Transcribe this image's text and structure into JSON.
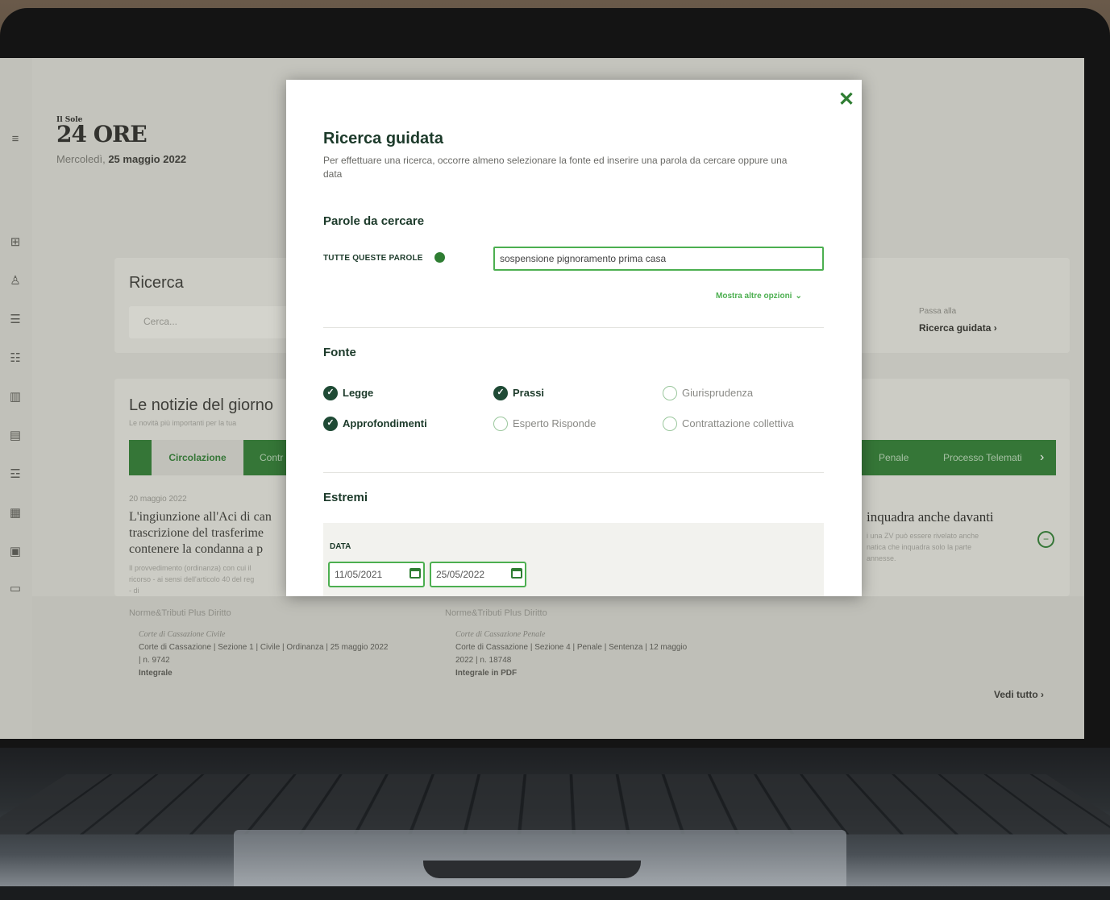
{
  "background": {
    "logo": "24 ORE",
    "logo_small": "Il Sole",
    "date_prefix": "Mercoledì,",
    "date_value": "25 maggio 2022",
    "search_title": "Ricerca",
    "search_placeholder": "Cerca...",
    "passa": "Passa alla",
    "ricerca_guidata_link": "Ricerca guidata",
    "news_title": "Le notizie del giorno",
    "news_subtitle": "Le novità più importanti per la tua",
    "tabs": [
      "Circolazione",
      "Contr",
      "Penale",
      "Processo Telemati"
    ],
    "news_date": "20 maggio 2022",
    "news_headline_lines": [
      "L'ingiunzione all'Aci di can",
      "trascrizione del trasferime",
      "contenere la condanna a p"
    ],
    "news_text_lines": [
      "Il provvedimento (ordinanza) con cui il",
      "ricorso - ai sensi dell'articolo 40 del reg",
      "- di"
    ],
    "right_headline": "inquadra anche davanti",
    "right_text_lines": [
      "i una ZV può essere rivelato anche",
      "natica che inquadra solo la parte",
      "annesse."
    ],
    "sources": [
      {
        "label": "Norme&Tributi Plus Diritto",
        "court_italic": "Corte di Cassazione Civile",
        "line1": "Corte di Cassazione | Sezione 1 | Civile | Ordinanza | 25 maggio 2022",
        "line2": "| n. 9742",
        "line3": "Integrale"
      },
      {
        "label": "Norme&Tributi Plus Diritto",
        "court_italic": "Corte di Cassazione Penale",
        "line1": "Corte di Cassazione | Sezione 4 | Penale | Sentenza | 12 maggio",
        "line2": "2022 | n. 18748",
        "line3": "Integrale in PDF"
      }
    ],
    "vedi_tutto": "Vedi tutto"
  },
  "modal": {
    "title": "Ricerca guidata",
    "description": "Per effettuare una ricerca, occorre almeno selezionare la fonte ed inserire una parola da cercare oppure una data",
    "section_words": "Parole da cercare",
    "all_words_label": "TUTTE QUESTE PAROLE",
    "all_words_value": "sospensione pignoramento prima casa",
    "more_options": "Mostra altre opzioni",
    "section_source": "Fonte",
    "sources": [
      {
        "label": "Legge",
        "checked": true
      },
      {
        "label": "Prassi",
        "checked": true
      },
      {
        "label": "Giurisprudenza",
        "checked": false
      },
      {
        "label": "Approfondimenti",
        "checked": true
      },
      {
        "label": "Esperto Risponde",
        "checked": false
      },
      {
        "label": "Contrattazione collettiva",
        "checked": false
      }
    ],
    "section_extremes": "Estremi",
    "date_label": "DATA",
    "date_from": "11/05/2021",
    "date_to": "25/05/2022"
  },
  "colors": {
    "accent": "#2e7d32",
    "accent_light": "#4caf50",
    "dark_text": "#1c3a2a"
  }
}
